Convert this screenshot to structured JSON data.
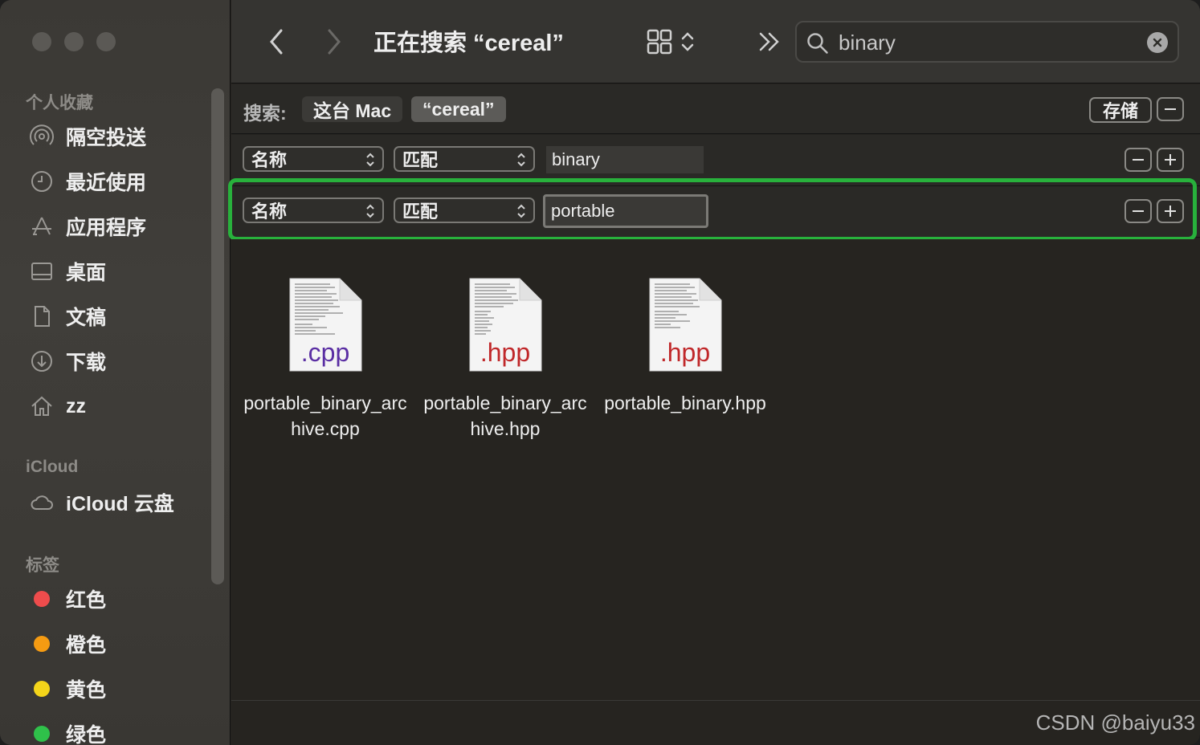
{
  "toolbar": {
    "title": "正在搜索 “cereal”",
    "search_value": "binary",
    "icons": [
      "chevron-left-icon",
      "chevron-right-icon",
      "grid-view-icon",
      "chevron-updown-icon",
      "more-chevrons-icon",
      "search-icon",
      "clear-icon"
    ]
  },
  "sidebar": {
    "favorites_header": "个人收藏",
    "favorites": [
      {
        "label": "隔空投送",
        "icon": "airdrop-icon"
      },
      {
        "label": "最近使用",
        "icon": "clock-icon"
      },
      {
        "label": "应用程序",
        "icon": "apps-icon"
      },
      {
        "label": "桌面",
        "icon": "desktop-icon"
      },
      {
        "label": "文稿",
        "icon": "document-icon"
      },
      {
        "label": "下载",
        "icon": "download-icon"
      },
      {
        "label": "zz",
        "icon": "home-icon"
      }
    ],
    "icloud_header": "iCloud",
    "icloud": [
      {
        "label": "iCloud 云盘",
        "icon": "cloud-icon"
      }
    ],
    "tags_header": "标签",
    "tags": [
      {
        "label": "红色",
        "color": "#ee4c4c"
      },
      {
        "label": "橙色",
        "color": "#f59b12"
      },
      {
        "label": "黄色",
        "color": "#f4d51a"
      },
      {
        "label": "绿色",
        "color": "#2fc14a"
      }
    ]
  },
  "scope": {
    "label": "搜索:",
    "this_mac": "这台 Mac",
    "folder": "“cereal”",
    "save": "存储"
  },
  "criteria": [
    {
      "attribute": "名称",
      "operator": "匹配",
      "value": "binary"
    },
    {
      "attribute": "名称",
      "operator": "匹配",
      "value": "portable"
    }
  ],
  "files": [
    {
      "name": "portable_binary_archive.cpp",
      "ext": ".cpp",
      "ext_color": "#5a2ea3"
    },
    {
      "name": "portable_binary_archive.hpp",
      "ext": ".hpp",
      "ext_color": "#c0282a"
    },
    {
      "name": "portable_binary.hpp",
      "ext": ".hpp",
      "ext_color": "#c0282a"
    }
  ],
  "watermark": "CSDN @baiyu33"
}
